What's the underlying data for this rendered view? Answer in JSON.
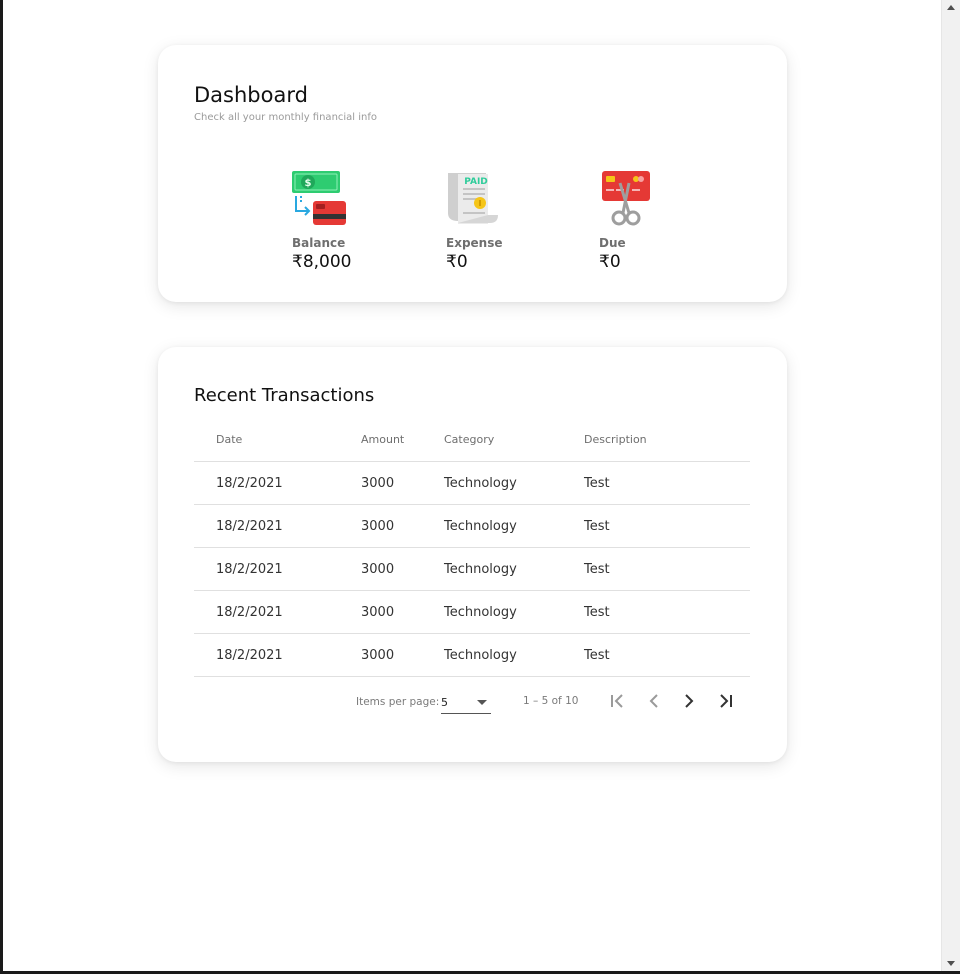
{
  "dashboard": {
    "title": "Dashboard",
    "subtitle": "Check all your monthly financial info",
    "stats": [
      {
        "label": "Balance",
        "value": "₹8,000",
        "icon": "money-transfer-icon"
      },
      {
        "label": "Expense",
        "value": "₹0",
        "icon": "paid-receipt-icon"
      },
      {
        "label": "Due",
        "value": "₹0",
        "icon": "card-scissors-icon"
      }
    ]
  },
  "transactions": {
    "title": "Recent Transactions",
    "columns": [
      "Date",
      "Amount",
      "Category",
      "Description"
    ],
    "rows": [
      {
        "date": "18/2/2021",
        "amount": "3000",
        "category": "Technology",
        "description": "Test"
      },
      {
        "date": "18/2/2021",
        "amount": "3000",
        "category": "Technology",
        "description": "Test"
      },
      {
        "date": "18/2/2021",
        "amount": "3000",
        "category": "Technology",
        "description": "Test"
      },
      {
        "date": "18/2/2021",
        "amount": "3000",
        "category": "Technology",
        "description": "Test"
      },
      {
        "date": "18/2/2021",
        "amount": "3000",
        "category": "Technology",
        "description": "Test"
      }
    ],
    "paginator": {
      "items_per_page_label": "Items per page:",
      "page_size": "5",
      "range_label": "1 – 5 of 10"
    }
  },
  "colors": {
    "money_green": "#2ecc71",
    "card_red": "#e53935",
    "receipt_gray": "#dcdcdc",
    "paid_green": "#2ecc9a",
    "coin_yellow": "#f5c518",
    "arrow_blue": "#29a8e0",
    "text_muted": "#9a9a9a"
  }
}
